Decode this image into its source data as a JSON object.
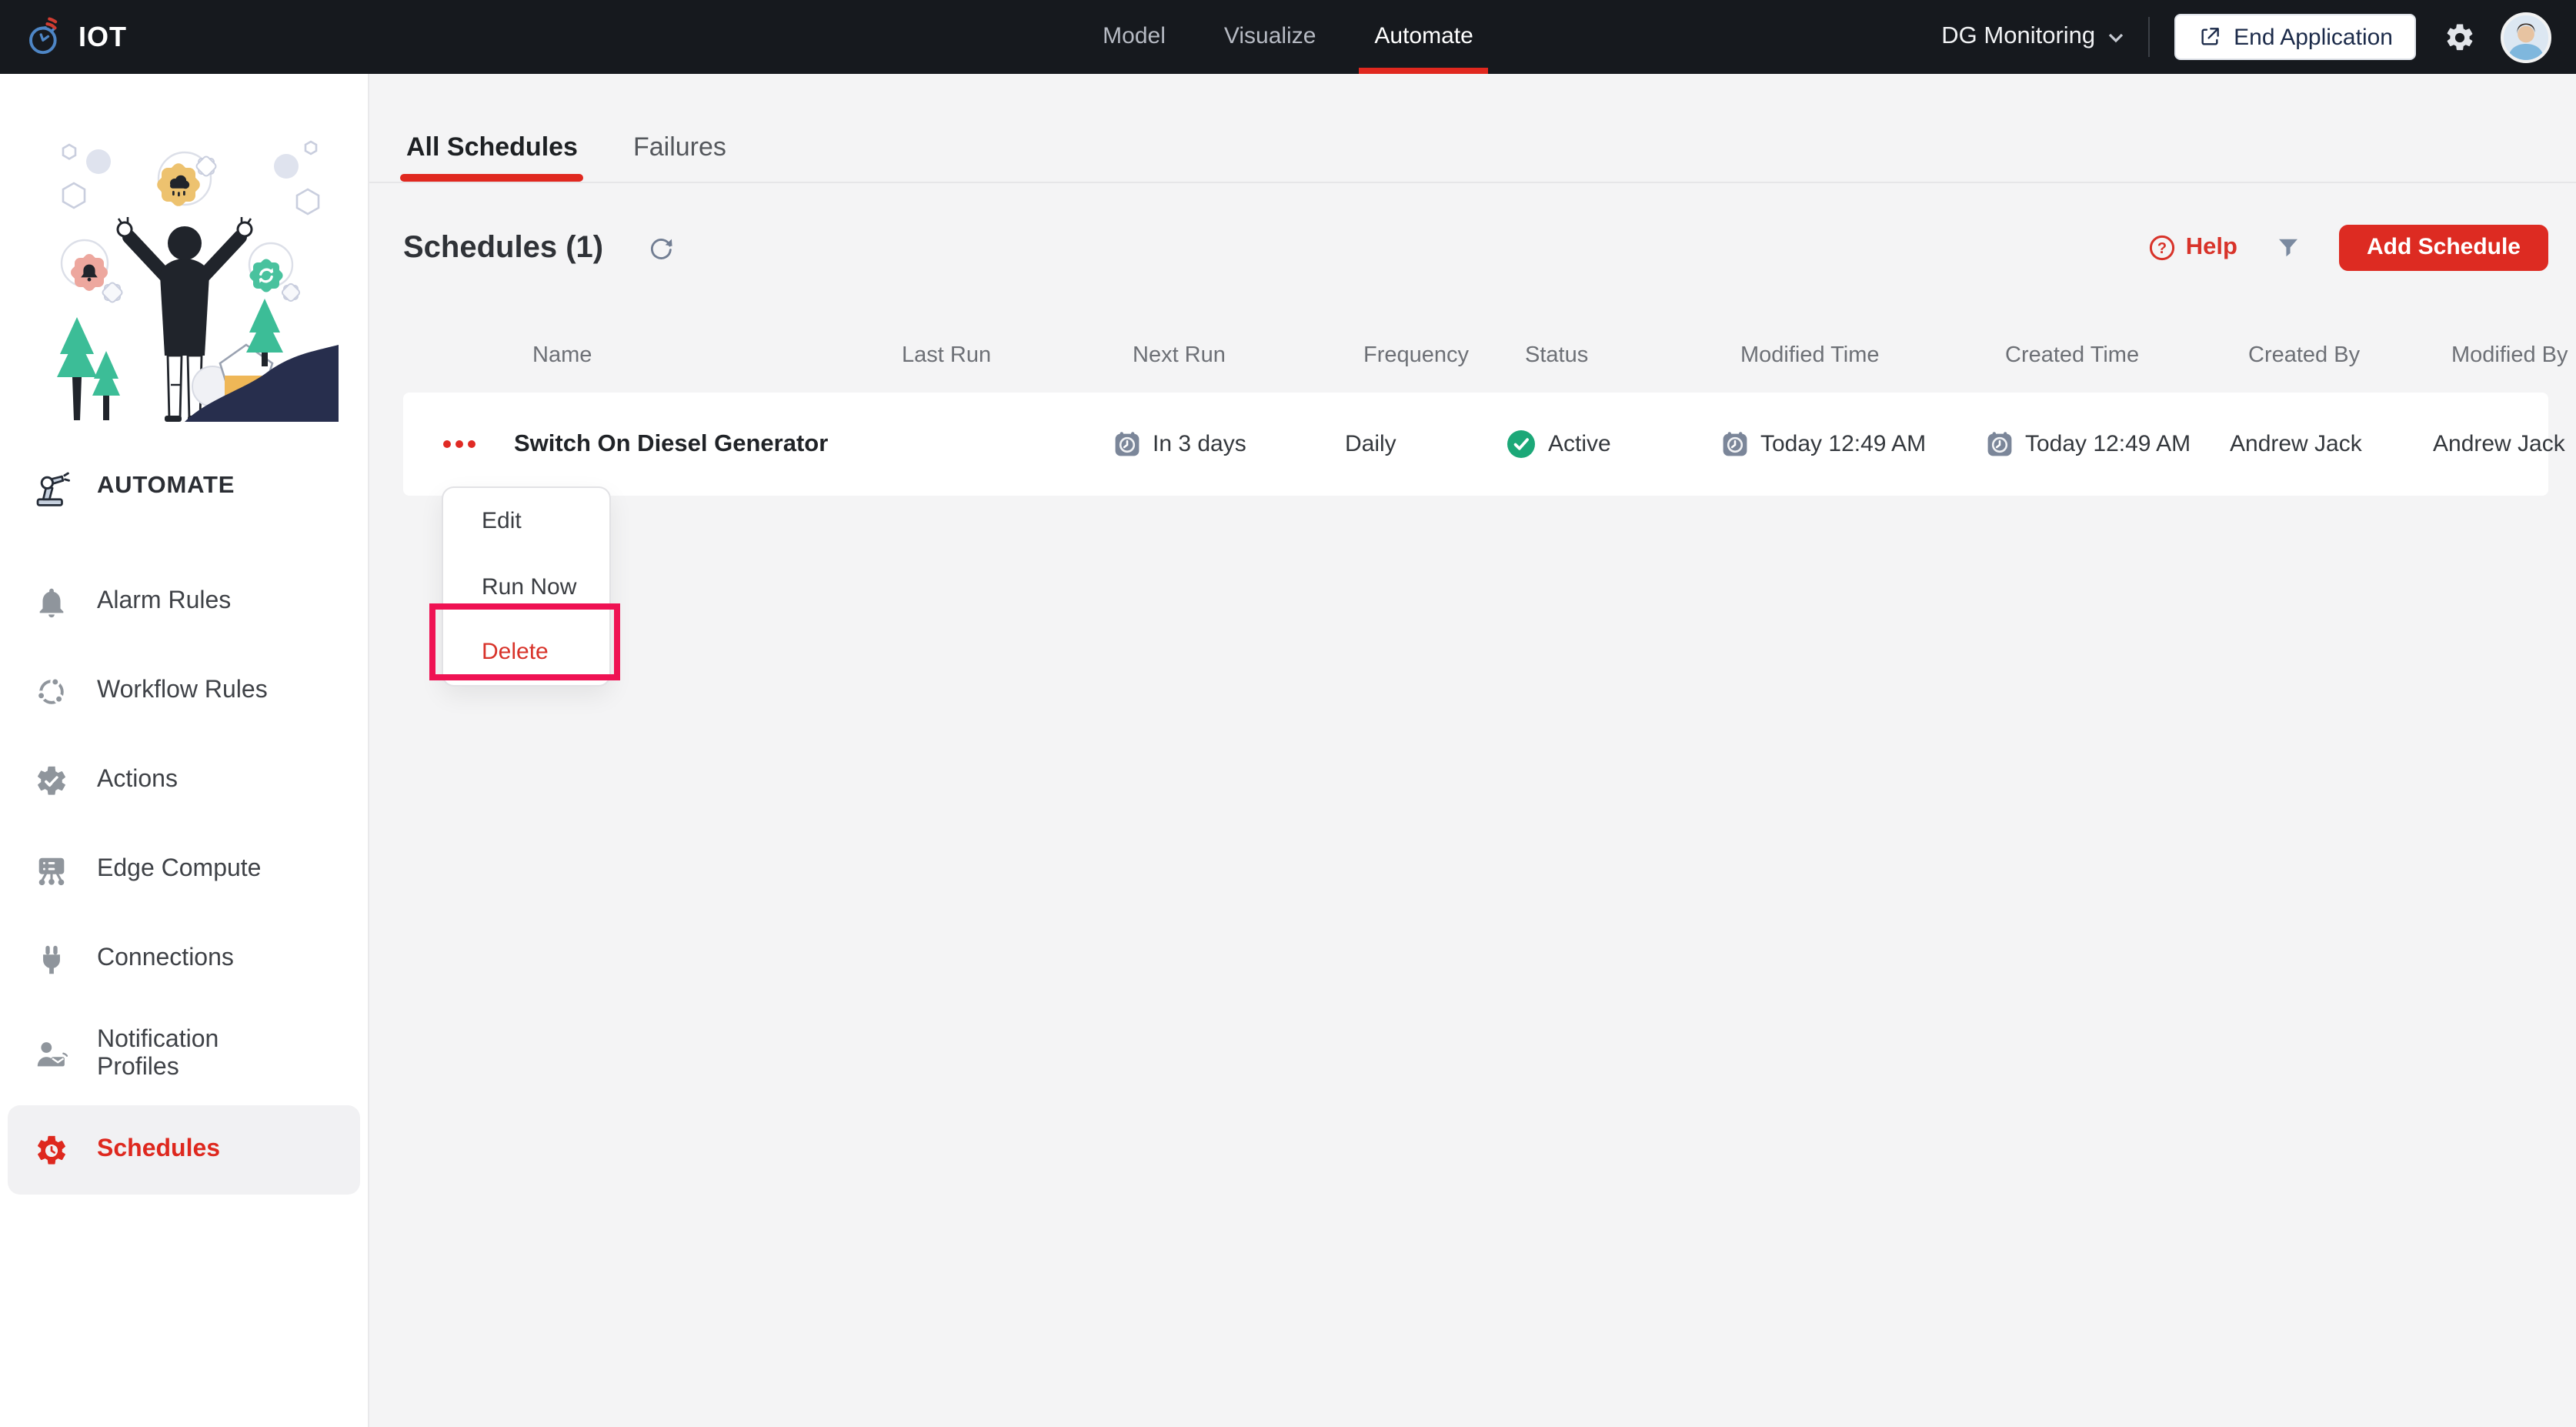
{
  "topbar": {
    "logo_text": "IOT",
    "nav": [
      {
        "label": "Model",
        "active": false
      },
      {
        "label": "Visualize",
        "active": false
      },
      {
        "label": "Automate",
        "active": true
      }
    ],
    "app_selector_label": "DG Monitoring",
    "end_application_label": "End Application"
  },
  "sidebar": {
    "section_label": "AUTOMATE",
    "items": [
      {
        "label": "Alarm Rules",
        "icon": "bell-icon",
        "active": false
      },
      {
        "label": "Workflow Rules",
        "icon": "workflow-icon",
        "active": false
      },
      {
        "label": "Actions",
        "icon": "gear-check-icon",
        "active": false
      },
      {
        "label": "Edge Compute",
        "icon": "server-icon",
        "active": false
      },
      {
        "label": "Connections",
        "icon": "plug-icon",
        "active": false
      },
      {
        "label": "Notification Profiles",
        "icon": "person-mail-icon",
        "active": false
      },
      {
        "label": "Schedules",
        "icon": "gear-clock-icon",
        "active": true
      }
    ]
  },
  "content": {
    "tabs": [
      {
        "label": "All Schedules",
        "active": true
      },
      {
        "label": "Failures",
        "active": false
      }
    ],
    "title": "Schedules (1)",
    "help_label": "Help",
    "add_schedule_label": "Add Schedule",
    "table": {
      "columns": [
        "Name",
        "Last Run",
        "Next Run",
        "Frequency",
        "Status",
        "Modified Time",
        "Created Time",
        "Created By",
        "Modified By"
      ],
      "row": {
        "name": "Switch On Diesel Generator",
        "last_run": "",
        "next_run": "In 3 days",
        "frequency": "Daily",
        "status": "Active",
        "modified_time": "Today 12:49 AM",
        "created_time": "Today 12:49 AM",
        "created_by": "Andrew Jack",
        "modified_by": "Andrew Jack"
      }
    },
    "context_menu": {
      "items": [
        {
          "label": "Edit"
        },
        {
          "label": "Run Now"
        },
        {
          "label": "Delete"
        }
      ],
      "highlighted_item": "Delete"
    }
  },
  "colors": {
    "accent_red": "#de281e",
    "annotation_pink": "#ef1253",
    "status_green": "#1ca878",
    "topbar_bg": "#16191e",
    "slate_icon": "#7b8699"
  }
}
